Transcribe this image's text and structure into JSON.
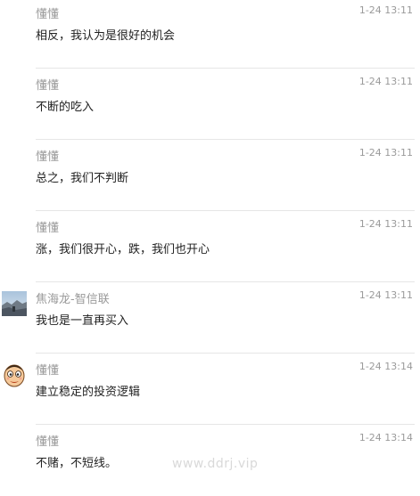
{
  "messages": [
    {
      "name": "懂懂",
      "time": "1-24 13:11",
      "text": "相反，我认为是很好的机会",
      "avatar": "none"
    },
    {
      "name": "懂懂",
      "time": "1-24 13:11",
      "text": "不断的吃入",
      "avatar": "none"
    },
    {
      "name": "懂懂",
      "time": "1-24 13:11",
      "text": "总之，我们不判断",
      "avatar": "none"
    },
    {
      "name": "懂懂",
      "time": "1-24 13:11",
      "text": "涨，我们很开心，跌，我们也开心",
      "avatar": "none"
    },
    {
      "name": "焦海龙-智信联",
      "time": "1-24 13:11",
      "text": "我也是一直再买入",
      "avatar": "landscape-photo-avatar"
    },
    {
      "name": "懂懂",
      "time": "1-24 13:14",
      "text": "建立稳定的投资逻辑",
      "avatar": "cartoon-face-avatar"
    },
    {
      "name": "懂懂",
      "time": "1-24 13:14",
      "text": "不赌，不短线。",
      "avatar": "none"
    }
  ],
  "watermark": "www.ddrj.vip",
  "colors": {
    "name": "#9a9a9a",
    "time": "#9a9a9a",
    "text": "#222222",
    "divider": "#e6e6e6"
  }
}
